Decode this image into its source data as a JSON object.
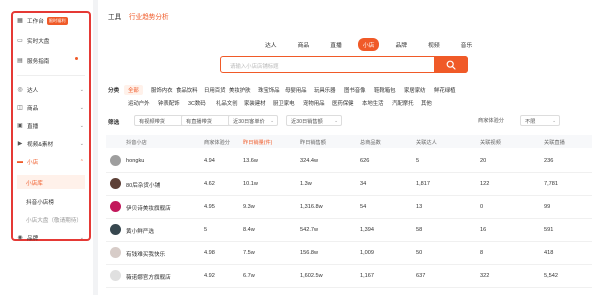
{
  "sidebar": {
    "workbench": {
      "label": "工作台",
      "badge": "限时福利"
    },
    "realtime": {
      "label": "实时大盘"
    },
    "service": {
      "label": "服务指南"
    },
    "items": [
      {
        "label": "达人"
      },
      {
        "label": "商品"
      },
      {
        "label": "直播"
      },
      {
        "label": "视频&素材"
      },
      {
        "label": "小店"
      }
    ],
    "sub_items": [
      {
        "label": "小店库"
      },
      {
        "label": "抖音小店榜"
      },
      {
        "label": "小店大盘（敬请期待）"
      }
    ],
    "brand": {
      "label": "品牌"
    }
  },
  "header": {
    "section": "工具",
    "page": "行业趋势分析"
  },
  "tabs": [
    {
      "label": "达人"
    },
    {
      "label": "商品"
    },
    {
      "label": "直播"
    },
    {
      "label": "小店"
    },
    {
      "label": "品牌"
    },
    {
      "label": "视频"
    },
    {
      "label": "音乐"
    }
  ],
  "search": {
    "placeholder": "请输入小店店铺标题"
  },
  "filters": {
    "category_label": "分类",
    "categories_row1": [
      "全部",
      "服饰内衣",
      "食品饮料",
      "日用百货",
      "美妆护肤",
      "珠宝饰品",
      "母婴用品",
      "玩具乐器",
      "图书音像",
      "鞋靴箱包",
      "家居家纺",
      "鲜花绿植"
    ],
    "categories_row2": [
      "运动户外",
      "钟表配饰",
      "3C数码",
      "礼品文创",
      "家装建材",
      "厨卫家电",
      "宠物用品",
      "医药保健",
      "本地生活",
      "汽配摩托",
      "其他"
    ],
    "screen_label": "筛选",
    "selects": [
      {
        "value": "有视频带货"
      },
      {
        "value": "有直播带货"
      },
      {
        "value": "近30日客单价"
      },
      {
        "value": "近30日销售额"
      },
      {
        "value": "商家体验分"
      },
      {
        "value": "不限"
      }
    ]
  },
  "table": {
    "headers": [
      "抖音小店",
      "商家体验分",
      "昨日销量(件)",
      "昨日销售额",
      "总商品数",
      "关联达人",
      "关联视频",
      "关联直播"
    ],
    "sorted_index": 2,
    "rows": [
      {
        "name": "hongku",
        "score": "4.94",
        "sales": "13.6w",
        "revenue": "324.4w",
        "products": "626",
        "creators": "5",
        "videos": "20",
        "lives": "236"
      },
      {
        "name": "80后杂货小铺",
        "score": "4.62",
        "sales": "10.1w",
        "revenue": "1.3w",
        "products": "34",
        "creators": "1,817",
        "videos": "122",
        "lives": "7,781"
      },
      {
        "name": "伊贝诗美妆旗舰店",
        "score": "4.95",
        "sales": "9.3w",
        "revenue": "1,316.8w",
        "products": "54",
        "creators": "13",
        "videos": "0",
        "lives": "99"
      },
      {
        "name": "黄小鲜严选",
        "score": "5",
        "sales": "8.4w",
        "revenue": "542.7w",
        "products": "1,394",
        "creators": "58",
        "videos": "16",
        "lives": "591"
      },
      {
        "name": "有钱难买我快乐",
        "score": "4.98",
        "sales": "7.5w",
        "revenue": "156.8w",
        "products": "1,009",
        "creators": "50",
        "videos": "8",
        "lives": "418"
      },
      {
        "name": "薇诺娜官方旗舰店",
        "score": "4.92",
        "sales": "6.7w",
        "revenue": "1,602.5w",
        "products": "1,167",
        "creators": "637",
        "videos": "322",
        "lives": "5,542"
      }
    ]
  },
  "colors": {
    "accent": "#f05a28",
    "frame": "#e53935"
  }
}
